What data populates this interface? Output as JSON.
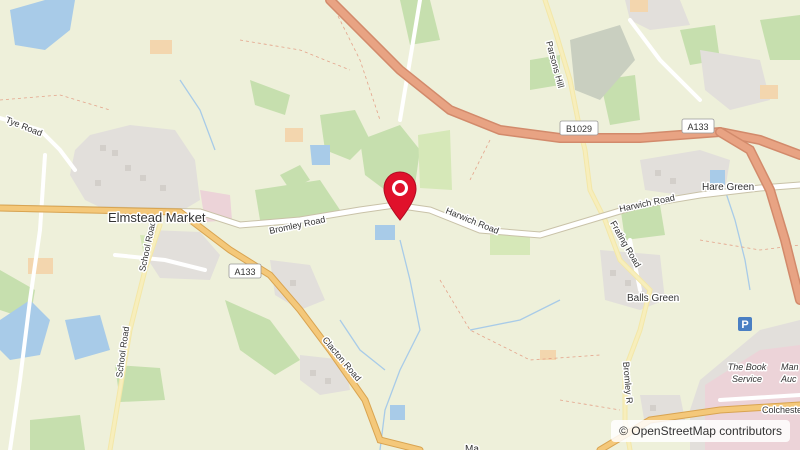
{
  "map": {
    "places": {
      "elmstead_market": "Elmstead Market",
      "hare_green": "Hare Green",
      "balls_green": "Balls Green",
      "max_partial": "Ma"
    },
    "roads": {
      "tye_road": "Tye Road",
      "bromley_road": "Bromley Road",
      "harwich_road_1": "Harwich Road",
      "harwich_road_2": "Harwich Road",
      "school_road_1": "School Road",
      "school_road_2": "School Road",
      "clacton_road": "Clacton Road",
      "parsons_hill": "Parsons Hill",
      "frating_road": "Frating Road",
      "bromley_road_south": "Bromley R",
      "colchester_partial": "Colcheste"
    },
    "shields": {
      "a133_north": "A133",
      "b1029": "B1029",
      "a133_west": "A133"
    },
    "pois": {
      "book_service_line1": "The Book",
      "book_service_line2": "Service",
      "manor_partial_1": "Man",
      "manor_partial_2": "Auc",
      "parking_symbol": "P"
    },
    "marker": {
      "color": "#e0112b",
      "icon": "location-pin-icon"
    },
    "attribution": "© OpenStreetMap contributors"
  },
  "colors": {
    "background": "#eef0da",
    "motorway": "#e8a383",
    "primary_road": "#f4c87a",
    "minor_road": "#ffffff",
    "water": "#a8cbe8",
    "woodland": "#bfdaa6",
    "urban": "#e2dfdb"
  }
}
